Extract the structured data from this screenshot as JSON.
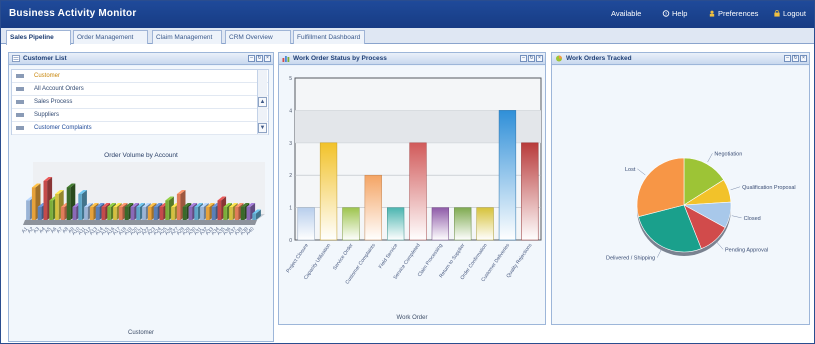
{
  "app": {
    "title": "Business Activity Monitor",
    "top_links": [
      {
        "label": "Available",
        "icon": "status-icon"
      },
      {
        "label": "Help",
        "icon": "help-icon"
      },
      {
        "label": "Preferences",
        "icon": "preferences-icon"
      },
      {
        "label": "Logout",
        "icon": "logout-icon"
      }
    ]
  },
  "tabs": [
    {
      "label": "Sales Pipeline",
      "active": true
    },
    {
      "label": "Order Management",
      "active": false
    },
    {
      "label": "Claim Management",
      "active": false
    },
    {
      "label": "CRM Overview",
      "active": false
    },
    {
      "label": "Fulfillment Dashboard",
      "active": false
    }
  ],
  "panel_left": {
    "title": "Customer List",
    "list_items": [
      "Customer",
      "All Account Orders",
      "Sales Process",
      "Suppliers",
      "Customer Complaints"
    ],
    "chart_title": "Order Volume by Account",
    "xlabel": "Customer"
  },
  "panel_middle": {
    "title": "Work Order Status by Process",
    "xlabel": "Work Order"
  },
  "panel_right": {
    "title": "Work Orders Tracked"
  },
  "colors": {
    "header": "#1f4a9a",
    "panel_border": "#9db6d9",
    "panel_bg": "#eaf2fb"
  },
  "chart_data": [
    {
      "type": "bar",
      "title": "Order Volume by Account",
      "xlabel": "Customer",
      "ylabel": "",
      "categories": [
        "A1",
        "A2",
        "A3",
        "A4",
        "A5",
        "A6",
        "A7",
        "A8",
        "A9",
        "A10",
        "A11",
        "A12",
        "A13",
        "A14",
        "A15",
        "A16",
        "A17",
        "A18",
        "A19",
        "A20",
        "A21",
        "A22",
        "A23",
        "A24",
        "A25",
        "A26",
        "A27",
        "A28",
        "A29",
        "A30",
        "A31",
        "A32",
        "A33",
        "A34",
        "A35",
        "A36",
        "A37",
        "A38",
        "A39",
        "A40"
      ],
      "values": [
        3,
        5,
        2,
        6,
        3,
        4,
        2,
        5,
        2,
        4,
        2,
        2,
        2,
        2,
        2,
        2,
        2,
        2,
        2,
        2,
        2,
        2,
        2,
        2,
        3,
        2,
        4,
        2,
        2,
        2,
        2,
        2,
        2,
        3,
        2,
        2,
        2,
        2,
        2,
        1
      ],
      "colors": [
        "#9ab4d6",
        "#e6a23c",
        "#5a7fb8",
        "#c44b4b",
        "#7cae3a",
        "#d4c040",
        "#e07d5a",
        "#3a6a2a",
        "#8a6ab8",
        "#5ea6c8"
      ],
      "ylim": [
        0,
        8
      ]
    },
    {
      "type": "bar",
      "title": "Work Order Status by Process",
      "xlabel": "Work Order",
      "ylabel": "",
      "categories": [
        "Project Closure",
        "Capacity Utilization",
        "Service Order",
        "Customer Complaints",
        "Field Service",
        "Service Completed",
        "Claim Processing",
        "Return to Supplier",
        "Order Confirmation",
        "Customer Deliveries",
        "Quality Rejections"
      ],
      "values": [
        1,
        3,
        1,
        2,
        1,
        3,
        1,
        1,
        1,
        4,
        3
      ],
      "colors": [
        "#b8ceec",
        "#f2c22a",
        "#9dc44d",
        "#f4a464",
        "#4bb5b0",
        "#d15a5a",
        "#8e5aa8",
        "#7eaa50",
        "#d6c23a",
        "#2f8fd8",
        "#b83a3a"
      ],
      "ylim": [
        0,
        5
      ]
    },
    {
      "type": "pie",
      "title": "",
      "slices": [
        {
          "label": "Negotiation",
          "value": 16,
          "color": "#9dc436"
        },
        {
          "label": "Qualification Proposal",
          "value": 8,
          "color": "#f2c22a"
        },
        {
          "label": "Closed",
          "value": 9,
          "color": "#a8c8ea"
        },
        {
          "label": "Pending Approval",
          "value": 11,
          "color": "#d14b4b"
        },
        {
          "label": "Delivered / Shipping",
          "value": 27,
          "color": "#1aa08c"
        },
        {
          "label": "Lost",
          "value": 29,
          "color": "#f79646"
        }
      ]
    }
  ]
}
